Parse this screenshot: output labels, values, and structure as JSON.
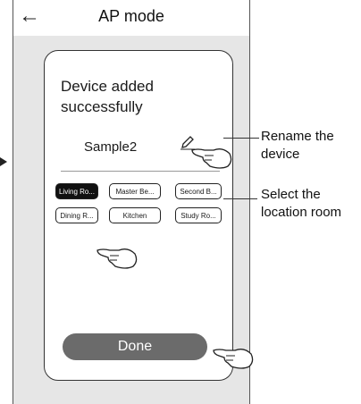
{
  "header": {
    "title": "AP mode",
    "back_icon": "back-arrow-icon"
  },
  "card": {
    "message": "Device added successfully",
    "device_name": "Sample2",
    "rooms": [
      "Living Ro...",
      "Master Be...",
      "Second B...",
      "Dining R...",
      "Kitchen",
      "Study Ro..."
    ],
    "selected_room": "Living Ro...",
    "done_label": "Done"
  },
  "annotations": {
    "rename": "Rename the device",
    "location": "Select the location room"
  }
}
